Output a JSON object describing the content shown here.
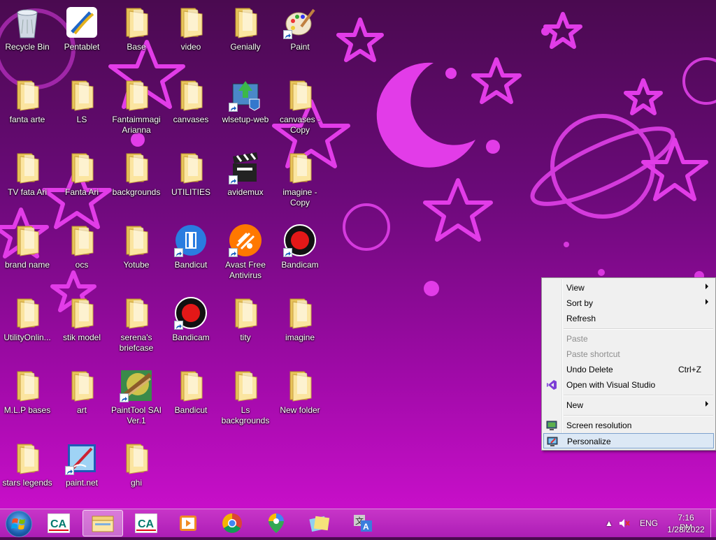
{
  "desktop": {
    "icons": [
      {
        "label": "Recycle Bin",
        "type": "recycle"
      },
      {
        "label": "Pentablet",
        "type": "app"
      },
      {
        "label": "Base",
        "type": "folder"
      },
      {
        "label": "video",
        "type": "folder"
      },
      {
        "label": "Genially",
        "type": "folder"
      },
      {
        "label": "Paint",
        "type": "paint"
      },
      {
        "label": "fanta arte",
        "type": "folder"
      },
      {
        "label": "LS",
        "type": "folder"
      },
      {
        "label": "Fantaimmagi Arianna",
        "type": "folder"
      },
      {
        "label": "canvases",
        "type": "folder"
      },
      {
        "label": "wlsetup-web",
        "type": "setup"
      },
      {
        "label": "canvases - Copy",
        "type": "folder"
      },
      {
        "label": "TV  fata Ari",
        "type": "folder"
      },
      {
        "label": "Fanta Ari",
        "type": "folder"
      },
      {
        "label": "backgrounds",
        "type": "folder"
      },
      {
        "label": "UTILITIES",
        "type": "folder"
      },
      {
        "label": "avidemux",
        "type": "clapper"
      },
      {
        "label": "imagine - Copy",
        "type": "folder"
      },
      {
        "label": "brand name",
        "type": "folder"
      },
      {
        "label": "ocs",
        "type": "folder"
      },
      {
        "label": "Yotube",
        "type": "folder"
      },
      {
        "label": "Bandicut",
        "type": "bandicut"
      },
      {
        "label": "Avast Free Antivirus",
        "type": "avast"
      },
      {
        "label": "Bandicam",
        "type": "bandicam"
      },
      {
        "label": "UtilityOnlin...",
        "type": "folder"
      },
      {
        "label": "stik  model",
        "type": "folder"
      },
      {
        "label": "serena's briefcase",
        "type": "folder"
      },
      {
        "label": "Bandicam",
        "type": "bandicam"
      },
      {
        "label": "tity",
        "type": "folder"
      },
      {
        "label": "imagine",
        "type": "folder"
      },
      {
        "label": "M.L.P bases",
        "type": "folder"
      },
      {
        "label": "art",
        "type": "folder"
      },
      {
        "label": "PaintTool SAI Ver.1",
        "type": "sai"
      },
      {
        "label": "Bandicut",
        "type": "folder"
      },
      {
        "label": "Ls backgrounds",
        "type": "folder"
      },
      {
        "label": "New folder",
        "type": "folder"
      },
      {
        "label": "stars legends",
        "type": "folder"
      },
      {
        "label": "paint.net",
        "type": "paintnet"
      },
      {
        "label": "ghi",
        "type": "folder"
      }
    ]
  },
  "context_menu": {
    "view": "View",
    "sort_by": "Sort by",
    "refresh": "Refresh",
    "paste": "Paste",
    "paste_shortcut": "Paste shortcut",
    "undo_delete": "Undo Delete",
    "undo_shortcut": "Ctrl+Z",
    "open_vs": "Open with Visual Studio",
    "new": "New",
    "screen_resolution": "Screen resolution",
    "personalize": "Personalize"
  },
  "taskbar": {
    "language": "ENG",
    "time": "7:16 PM",
    "date": "1/28/2022",
    "apps": [
      "credit-agricole",
      "file-explorer",
      "credit-agricole",
      "video-player",
      "chrome",
      "google-maps",
      "sticky-notes",
      "translator"
    ]
  },
  "colors": {
    "accent": "#d010d0",
    "menu_highlight": "#dce8f5"
  }
}
